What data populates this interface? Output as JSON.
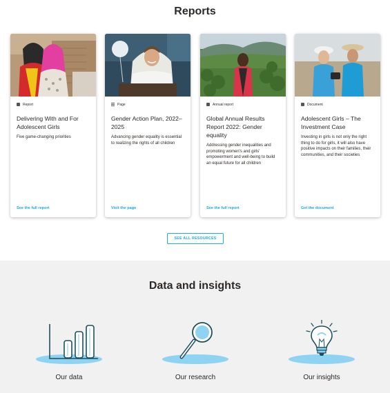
{
  "reports": {
    "title": "Reports",
    "cards": [
      {
        "type": "Report",
        "type_icon": "document-icon",
        "title": "Delivering With and For Adolescent Girls",
        "description": "Five game-changing priorities",
        "link": "See the full report"
      },
      {
        "type": "Page",
        "type_icon": "page-icon",
        "title": "Gender Action Plan, 2022–2025",
        "description": "Advancing gender equality is essential to realizing the rights of all children",
        "link": "Visit the page"
      },
      {
        "type": "Annual report",
        "type_icon": "document-icon",
        "title": "Global Annual Results Report 2022: Gender equality",
        "description": "Addressing gender inequalities and promoting women's and girls' empowerment and well-being to build an equal future for all children",
        "link": "See the full report"
      },
      {
        "type": "Document",
        "type_icon": "document-icon",
        "title": "Adolescent Girls – The Investment Case",
        "description": "Investing in girls is not only the right thing to do for girls, it will also have positive impacts on their families, their communities, and their societies",
        "link": "Get the document"
      }
    ],
    "see_all_label": "SEE ALL RESOURCES"
  },
  "data_insights": {
    "title": "Data and insights",
    "items": [
      {
        "label": "Our data",
        "icon": "bar-chart-icon"
      },
      {
        "label": "Our research",
        "icon": "magnifier-icon"
      },
      {
        "label": "Our insights",
        "icon": "lightbulb-icon"
      }
    ]
  },
  "colors": {
    "accent": "#1cabe2",
    "text": "#2d2926",
    "section_bg": "#f1f1f1",
    "icon_blue": "#8ed3f1"
  }
}
